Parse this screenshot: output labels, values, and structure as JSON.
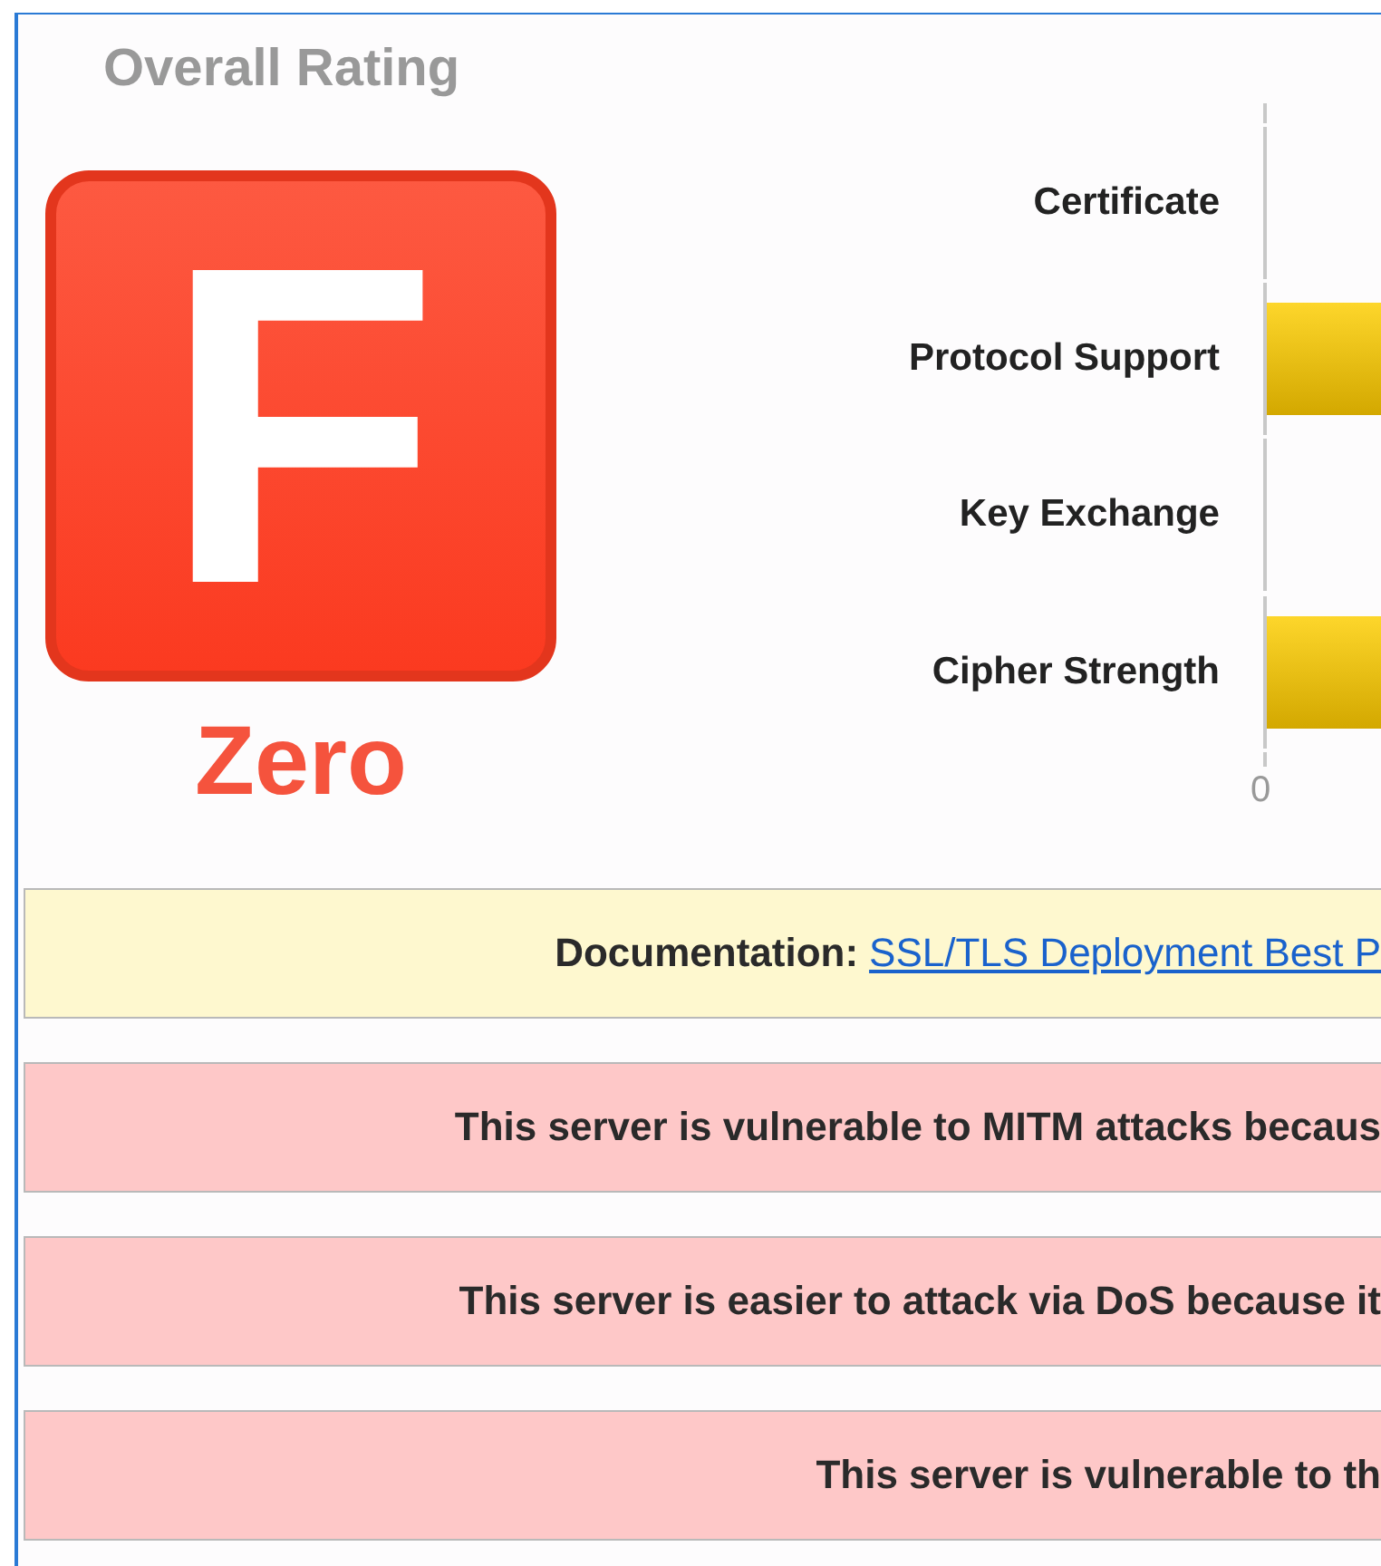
{
  "overall_rating": {
    "title": "Overall Rating",
    "grade": "F",
    "score_label": "Zero"
  },
  "score_chart": {
    "rows": [
      {
        "label": "Certificate",
        "has_bar": false
      },
      {
        "label": "Protocol Support",
        "has_bar": true
      },
      {
        "label": "Key Exchange",
        "has_bar": false
      },
      {
        "label": "Cipher Strength",
        "has_bar": true
      }
    ],
    "axis_label": "0"
  },
  "banners": [
    {
      "kind": "info",
      "label": "Documentation:",
      "link": "SSL/TLS Deployment Best P"
    },
    {
      "kind": "error",
      "text": "This server is vulnerable to MITM attacks becaus"
    },
    {
      "kind": "error",
      "text": "This server is easier to attack via DoS because it"
    },
    {
      "kind": "error",
      "text": "This server is vulnerable to th"
    }
  ]
}
